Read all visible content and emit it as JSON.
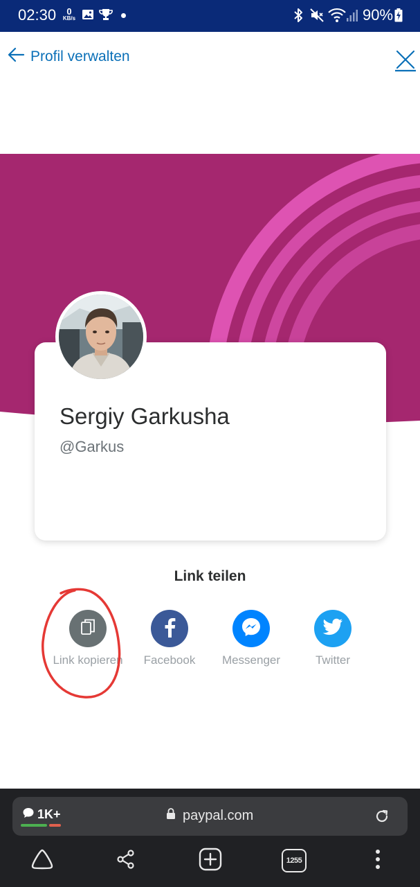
{
  "status_bar": {
    "time": "02:30",
    "net_speed_value": "0",
    "net_speed_unit": "KB/s",
    "battery": "90%"
  },
  "header": {
    "back_label": "Profil verwalten"
  },
  "profile": {
    "name": "Sergiy Garkusha",
    "handle": "@Garkus"
  },
  "share": {
    "title": "Link teilen",
    "items": [
      {
        "label": "Link kopieren",
        "icon": "copy-icon",
        "color": "#687173"
      },
      {
        "label": "Facebook",
        "icon": "facebook-icon",
        "color": "#3b5998"
      },
      {
        "label": "Messenger",
        "icon": "messenger-icon",
        "color": "#0084ff"
      },
      {
        "label": "Twitter",
        "icon": "twitter-icon",
        "color": "#1da1f2"
      }
    ]
  },
  "browser": {
    "tabs_label": "1K+",
    "url": "paypal.com",
    "tab_count": "1255"
  },
  "colors": {
    "status_bar_bg": "#0a2a78",
    "banner_bg": "#a5276f",
    "banner_rings": "#e055b5",
    "link_blue": "#0b70b8",
    "highlight_red": "#e53935"
  }
}
